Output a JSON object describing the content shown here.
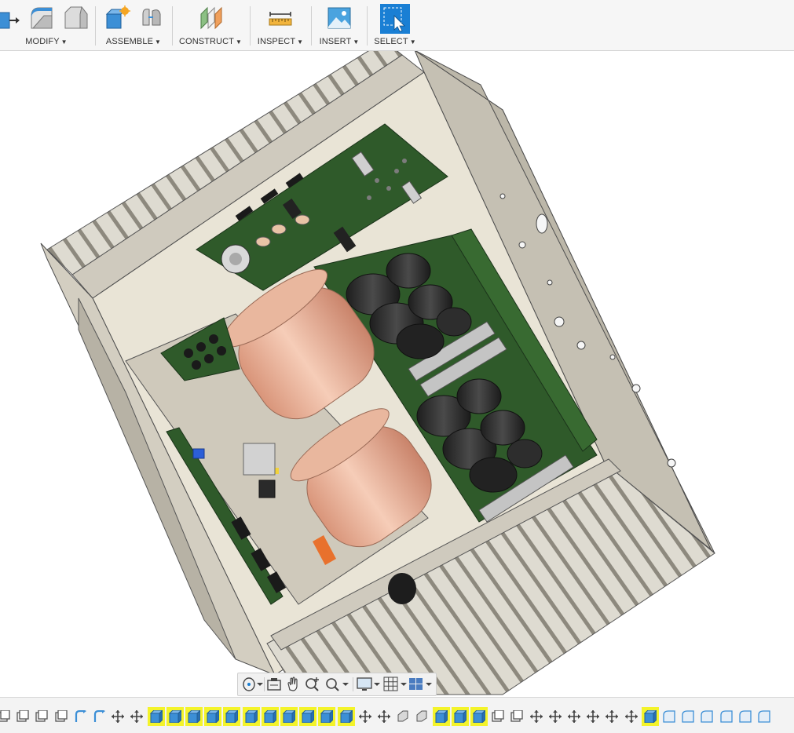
{
  "toolbar": {
    "groups": [
      {
        "label": "MODIFY",
        "icons": [
          "press-pull-icon",
          "fillet-icon",
          "chamfer-icon"
        ]
      },
      {
        "label": "ASSEMBLE",
        "icons": [
          "new-component-icon",
          "joint-icon"
        ]
      },
      {
        "label": "CONSTRUCT",
        "icons": [
          "offset-plane-icon"
        ]
      },
      {
        "label": "INSPECT",
        "icons": [
          "measure-icon"
        ]
      },
      {
        "label": "INSERT",
        "icons": [
          "insert-image-icon"
        ]
      },
      {
        "label": "SELECT",
        "icons": [
          "select-cursor-icon"
        ]
      }
    ],
    "active_group": "SELECT",
    "caret": "▼"
  },
  "viewport": {
    "model": "amplifier-enclosure-assembly",
    "colors": {
      "chassis": "#c9c4b8",
      "heatsink": "#d6d2c6",
      "pcb": "#2f5a2a",
      "transformer": "#e3ab8f",
      "capacitor": "#2b2b2b"
    }
  },
  "navbar": {
    "tools": [
      "orbit-icon",
      "look-at-icon",
      "pan-icon",
      "zoom-icon",
      "fit-icon",
      "display-settings-icon",
      "grid-icon",
      "viewports-icon"
    ]
  },
  "timeline": {
    "items": [
      {
        "type": "sketch",
        "hl": false
      },
      {
        "type": "sketch",
        "hl": false
      },
      {
        "type": "sketch",
        "hl": false
      },
      {
        "type": "sketch",
        "hl": false
      },
      {
        "type": "revolve",
        "hl": false
      },
      {
        "type": "revolve",
        "hl": false
      },
      {
        "type": "move",
        "hl": false
      },
      {
        "type": "move",
        "hl": false
      },
      {
        "type": "body",
        "hl": true
      },
      {
        "type": "body",
        "hl": true
      },
      {
        "type": "body",
        "hl": true
      },
      {
        "type": "body",
        "hl": true
      },
      {
        "type": "body",
        "hl": true
      },
      {
        "type": "body",
        "hl": true
      },
      {
        "type": "body",
        "hl": true
      },
      {
        "type": "body",
        "hl": true
      },
      {
        "type": "body",
        "hl": true
      },
      {
        "type": "body",
        "hl": true
      },
      {
        "type": "body",
        "hl": true
      },
      {
        "type": "move",
        "hl": false
      },
      {
        "type": "move",
        "hl": false
      },
      {
        "type": "extrude",
        "hl": false
      },
      {
        "type": "extrude",
        "hl": false
      },
      {
        "type": "body",
        "hl": true
      },
      {
        "type": "body",
        "hl": true
      },
      {
        "type": "body",
        "hl": true
      },
      {
        "type": "sketch",
        "hl": false
      },
      {
        "type": "sketch",
        "hl": false
      },
      {
        "type": "move",
        "hl": false
      },
      {
        "type": "move",
        "hl": false
      },
      {
        "type": "move",
        "hl": false
      },
      {
        "type": "move",
        "hl": false
      },
      {
        "type": "move",
        "hl": false
      },
      {
        "type": "move",
        "hl": false
      },
      {
        "type": "body",
        "hl": true
      },
      {
        "type": "fillet",
        "hl": false
      },
      {
        "type": "fillet",
        "hl": false
      },
      {
        "type": "fillet",
        "hl": false
      },
      {
        "type": "fillet",
        "hl": false
      },
      {
        "type": "fillet",
        "hl": false
      },
      {
        "type": "fillet",
        "hl": false
      }
    ],
    "highlight_color": "#f3f32a"
  }
}
